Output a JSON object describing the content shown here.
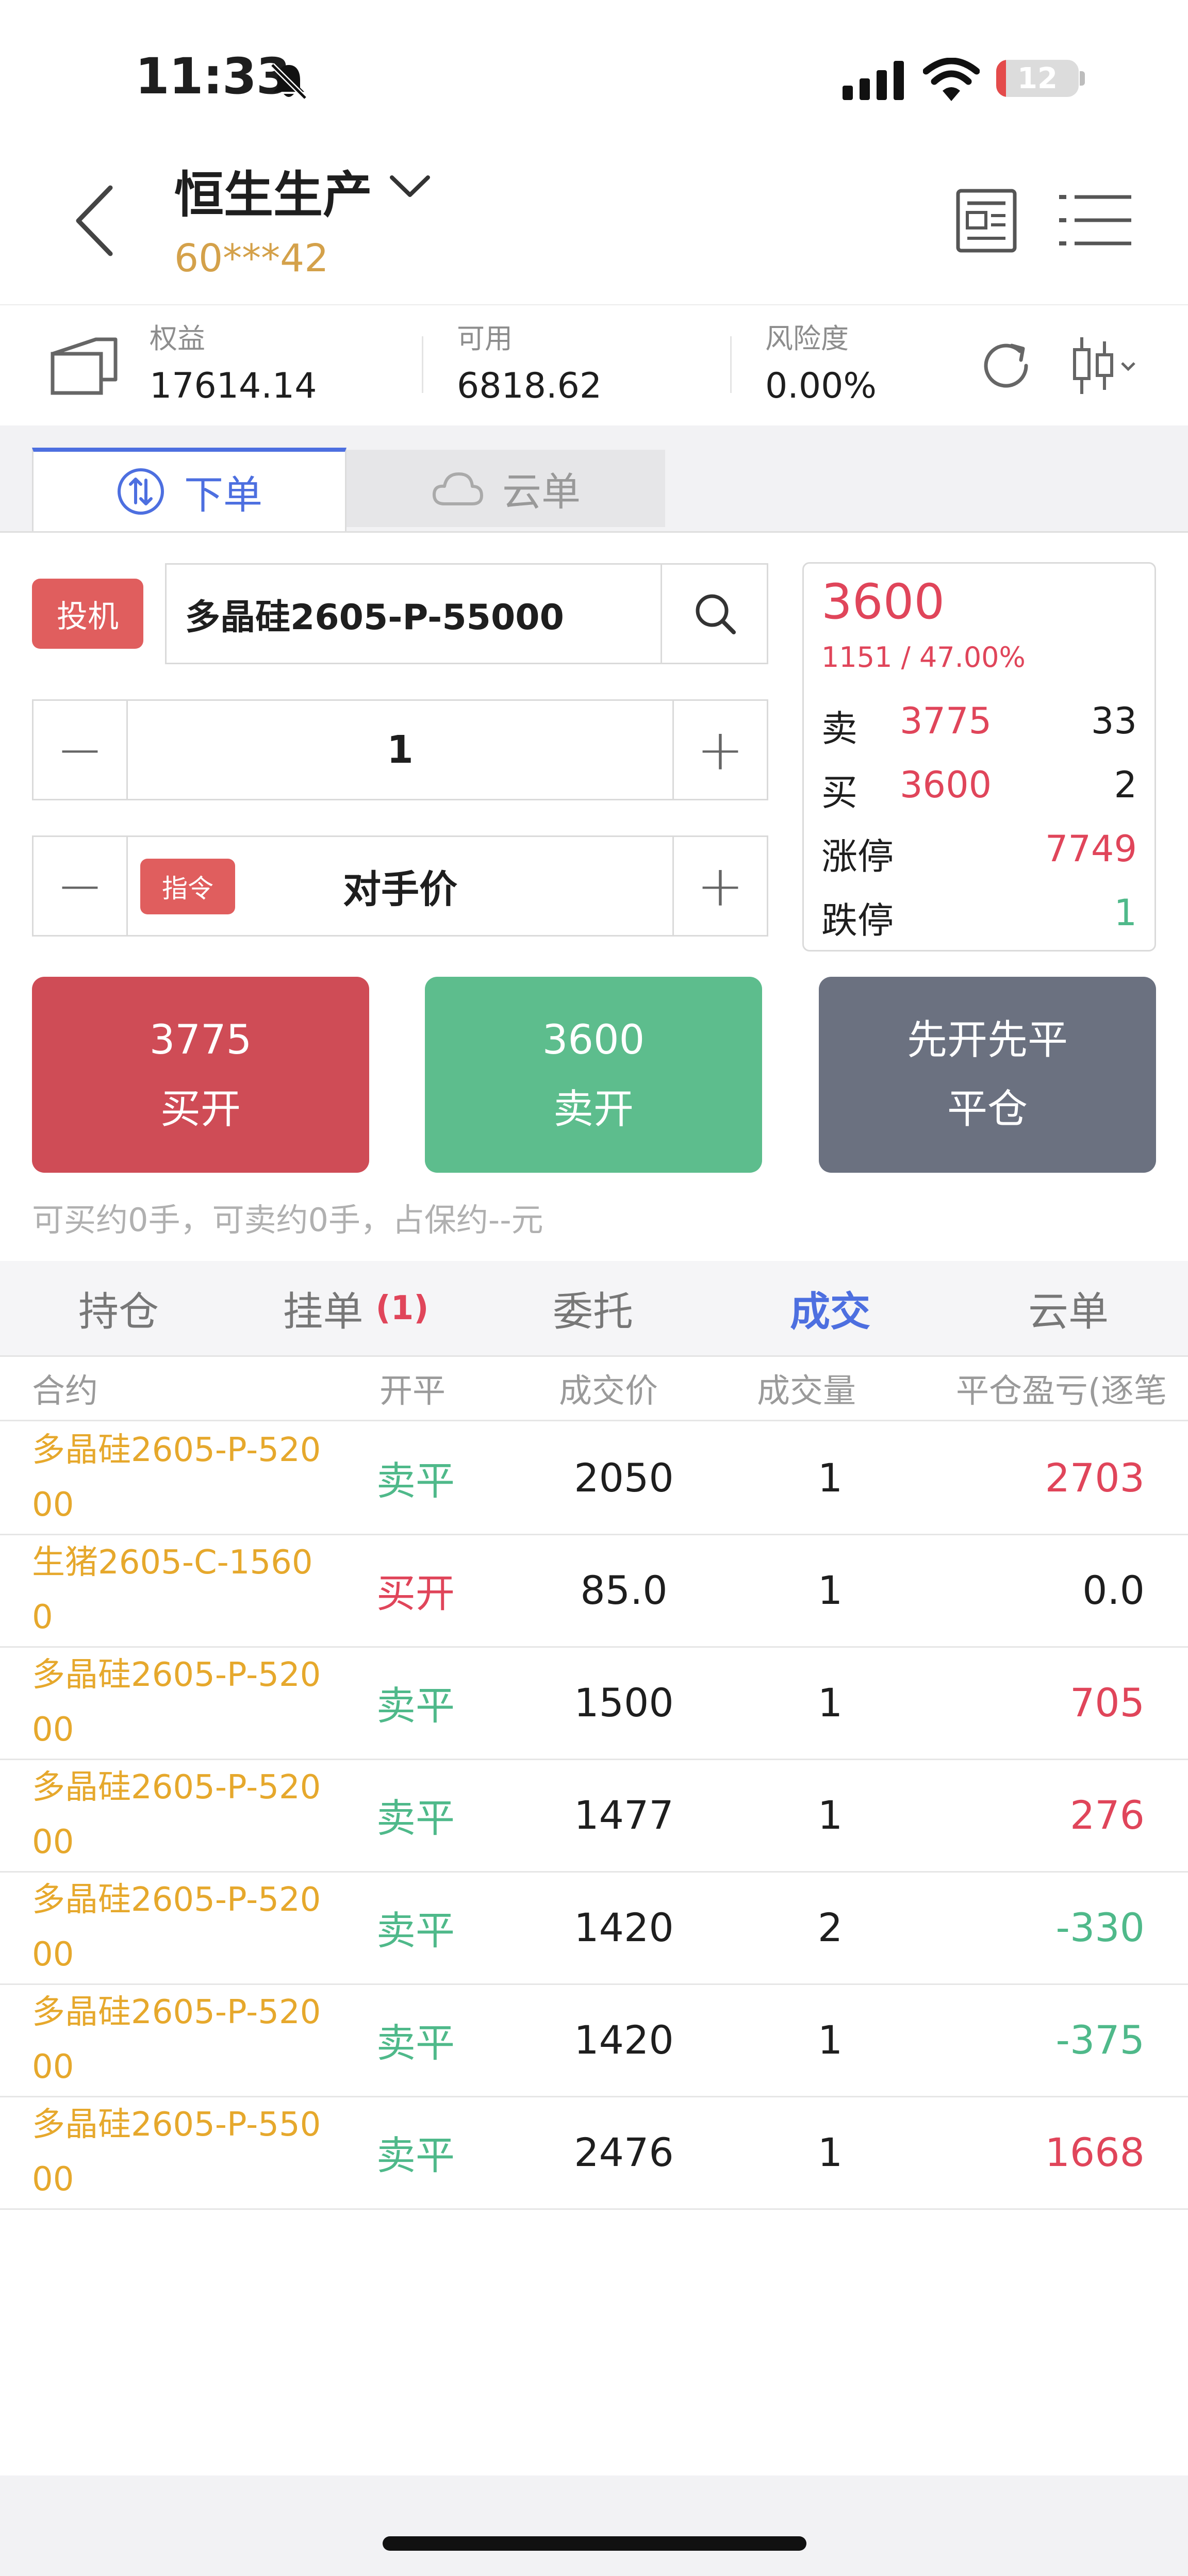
{
  "status_bar": {
    "time": "11:33",
    "battery_level": "12",
    "battery_fraction": 0.12
  },
  "header": {
    "account_name": "恒生生产",
    "account_id": "60***42"
  },
  "funds": [
    {
      "label": "权益",
      "value": "17614.14"
    },
    {
      "label": "可用",
      "value": "6818.62"
    },
    {
      "label": "风险度",
      "value": "0.00%"
    }
  ],
  "order_tabs": [
    {
      "label": "下单",
      "active": true
    },
    {
      "label": "云单",
      "active": false
    }
  ],
  "order_form": {
    "speculation_label": "投机",
    "contract": "多晶硅2605-P-55000",
    "quantity": "1",
    "price_type_badge": "指令",
    "price_type": "对手价",
    "minus": "−",
    "plus": "+"
  },
  "quote": {
    "last": "3600",
    "change": "1151 / 47.00%",
    "ask_label": "卖",
    "ask_price": "3775",
    "ask_vol": "33",
    "bid_label": "买",
    "bid_price": "3600",
    "bid_vol": "2",
    "limit_up_label": "涨停",
    "limit_up": "7749",
    "limit_down_label": "跌停",
    "limit_down": "1"
  },
  "actions": {
    "buy_open": {
      "price": "3775",
      "label": "买开"
    },
    "sell_open": {
      "price": "3600",
      "label": "卖开"
    },
    "close": {
      "line1": "先开先平",
      "line2": "平仓"
    }
  },
  "hint": "可买约0手，可卖约0手，占保约--元",
  "lower_tabs": [
    {
      "label": "持仓"
    },
    {
      "label": "挂单",
      "badge": "(1)"
    },
    {
      "label": "委托"
    },
    {
      "label": "成交",
      "active": true
    },
    {
      "label": "云单"
    }
  ],
  "trades": {
    "columns": [
      "合约",
      "开平",
      "成交价",
      "成交量",
      "平仓盈亏(逐笔"
    ],
    "rows": [
      {
        "contract": "多晶硅2605-P-52000",
        "oc": "卖平",
        "price": "2050",
        "qty": "1",
        "pl": "2703"
      },
      {
        "contract": "生猪2605-C-15600",
        "oc": "买开",
        "price": "85.0",
        "qty": "1",
        "pl": "0.0"
      },
      {
        "contract": "多晶硅2605-P-52000",
        "oc": "卖平",
        "price": "1500",
        "qty": "1",
        "pl": "705"
      },
      {
        "contract": "多晶硅2605-P-52000",
        "oc": "卖平",
        "price": "1477",
        "qty": "1",
        "pl": "276"
      },
      {
        "contract": "多晶硅2605-P-52000",
        "oc": "卖平",
        "price": "1420",
        "qty": "2",
        "pl": "-330"
      },
      {
        "contract": "多晶硅2605-P-52000",
        "oc": "卖平",
        "price": "1420",
        "qty": "1",
        "pl": "-375"
      },
      {
        "contract": "多晶硅2605-P-55000",
        "oc": "卖平",
        "price": "2476",
        "qty": "1",
        "pl": "1668"
      }
    ]
  },
  "colors": {
    "up": "#e0455a",
    "down": "#4fb98a",
    "accent": "#4d6fe0",
    "buy_btn": "#cf4c56",
    "sell_btn": "#5dbd8d",
    "close_btn": "#6b7180",
    "contract": "#e6a82c"
  }
}
